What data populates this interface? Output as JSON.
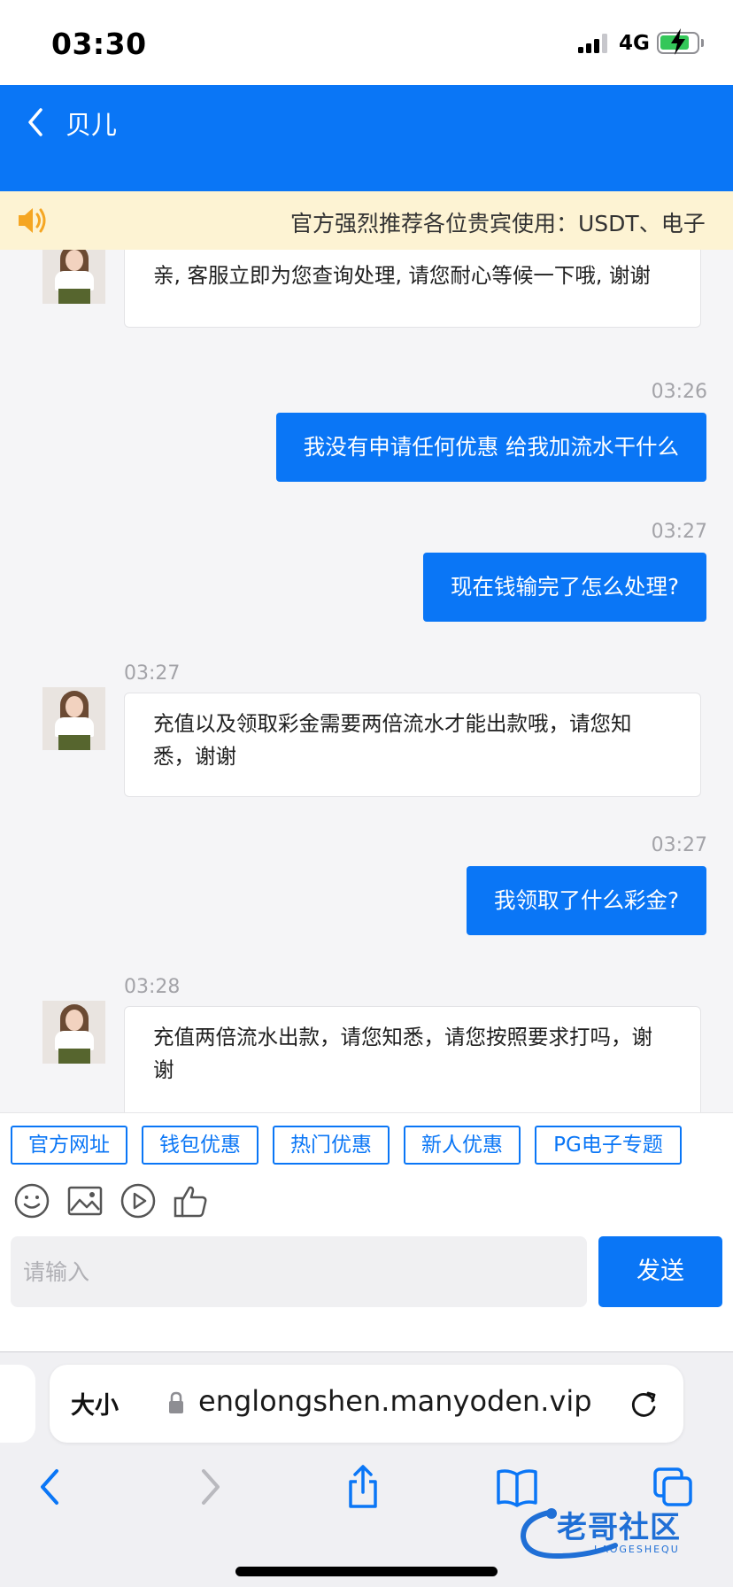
{
  "status_bar": {
    "time": "03:30",
    "network": "4G"
  },
  "header": {
    "title": "贝儿"
  },
  "marquee": {
    "text": "官方强烈推荐各位贵宾使用：USDT、电子"
  },
  "messages": [
    {
      "side": "in",
      "text": "亲, 客服立即为您查询处理, 请您耐心等候一下哦, 谢谢"
    },
    {
      "side": "out",
      "time": "03:26",
      "text": "我没有申请任何优惠 给我加流水干什么"
    },
    {
      "side": "out",
      "time": "03:27",
      "text": "现在钱输完了怎么处理?"
    },
    {
      "side": "in",
      "time": "03:27",
      "text": "充值以及领取彩金需要两倍流水才能出款哦，请您知悉，谢谢"
    },
    {
      "side": "out",
      "time": "03:27",
      "text": "我领取了什么彩金?"
    },
    {
      "side": "in",
      "time": "03:28",
      "text": "充值两倍流水出款，请您知悉，请您按照要求打吗，谢谢"
    }
  ],
  "quick_replies": [
    "官方网址",
    "钱包优惠",
    "热门优惠",
    "新人优惠",
    "PG电子专题"
  ],
  "input": {
    "placeholder": "请输入"
  },
  "send_label": "发送",
  "browser": {
    "text_size_label": "大小",
    "url": "englongshen.manyoden.vip"
  },
  "watermark": {
    "text": "老哥社区",
    "sub": "LAOGESHEQU"
  },
  "colors": {
    "primary": "#0a76f6",
    "marquee_bg": "#fdf3d3",
    "battery": "#34c759"
  },
  "icons": [
    "back-icon",
    "speaker-icon",
    "emoji-icon",
    "image-icon",
    "video-icon",
    "thumbs-up-icon",
    "lock-icon",
    "reload-icon",
    "browser-back-icon",
    "browser-forward-icon",
    "share-icon",
    "bookmarks-icon",
    "tabs-icon"
  ]
}
